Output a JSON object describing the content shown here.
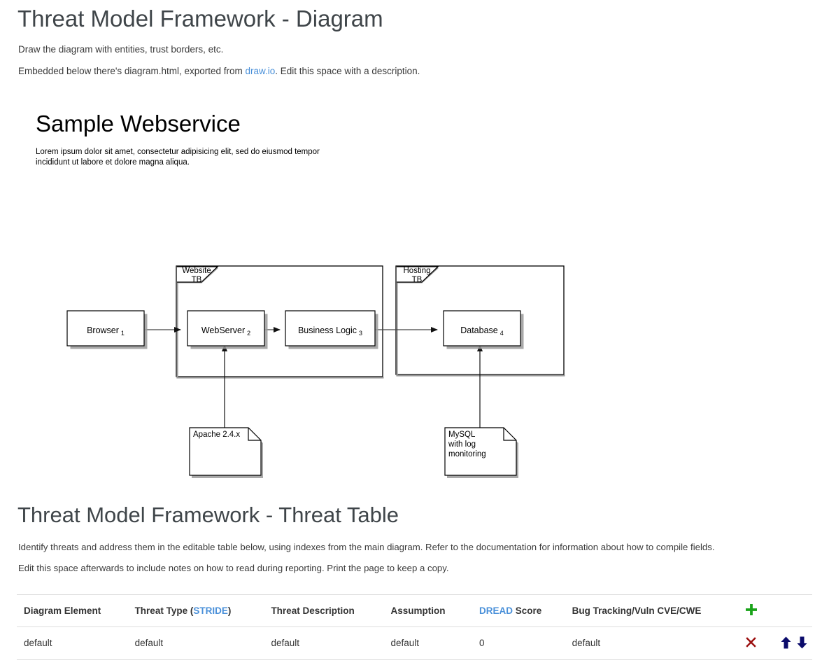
{
  "page": {
    "title": "Threat Model Framework - Diagram",
    "paragraph_1": "Draw the diagram with entities, trust borders, etc.",
    "paragraph_2_before": "Embedded below there's diagram.html, exported from ",
    "paragraph_2_link": "draw.io",
    "paragraph_2_after": ". Edit this space with a description."
  },
  "diagram": {
    "title": "Sample Webservice",
    "subtitle": "Lorem ipsum dolor sit amet, consectetur adipisicing elit, sed do eiusmod tempor incididunt ut labore et dolore magna aliqua.",
    "trust_boundaries": [
      {
        "id": "website-tb",
        "label_line_1": "Website",
        "label_line_2": "TB"
      },
      {
        "id": "hosting-tb",
        "label_line_1": "Hosting",
        "label_line_2": "TB"
      }
    ],
    "nodes": [
      {
        "id": "browser",
        "label": "Browser",
        "index": "1"
      },
      {
        "id": "webserver",
        "label": "WebServer",
        "index": "2"
      },
      {
        "id": "business-logic",
        "label": "Business Logic",
        "index": "3"
      },
      {
        "id": "database",
        "label": "Database",
        "index": "4"
      }
    ],
    "notes": [
      {
        "id": "apache-note",
        "lines": [
          "Apache 2.4.x"
        ]
      },
      {
        "id": "mysql-note",
        "lines": [
          "MySQL",
          "with log",
          "monitoring"
        ]
      }
    ]
  },
  "threat_section": {
    "title": "Threat Model Framework - Threat Table",
    "paragraph_1": "Identify threats and address them in the editable table below, using indexes from the main diagram. Refer to the documentation for information about how to compile fields.",
    "paragraph_2": "Edit this space afterwards to include notes on how to read during reporting. Print the page to keep a copy."
  },
  "table": {
    "headers": {
      "diagram_element": "Diagram Element",
      "threat_type_before": "Threat Type (",
      "threat_type_accent": "STRIDE",
      "threat_type_after": ")",
      "threat_description": "Threat Description",
      "assumption": "Assumption",
      "dread_accent": "DREAD",
      "dread_after": " Score",
      "bug_tracking": "Bug Tracking/Vuln CVE/CWE"
    },
    "add_row_icon": "plus-icon",
    "rows": [
      {
        "diagram_element": "default",
        "threat_type": "default",
        "threat_description": "default",
        "assumption": "default",
        "dread_score": "0",
        "bug_tracking": "default",
        "delete_icon": "x-icon",
        "move_up_icon": "arrow-up-icon",
        "move_down_icon": "arrow-down-icon"
      }
    ]
  },
  "colors": {
    "accent_link": "#4a90d9",
    "add_green": "#19a319",
    "delete_red": "#9b0f0f",
    "move_navy": "#0b0b6b",
    "heading": "#3f4549",
    "table_border": "#dddddd"
  }
}
